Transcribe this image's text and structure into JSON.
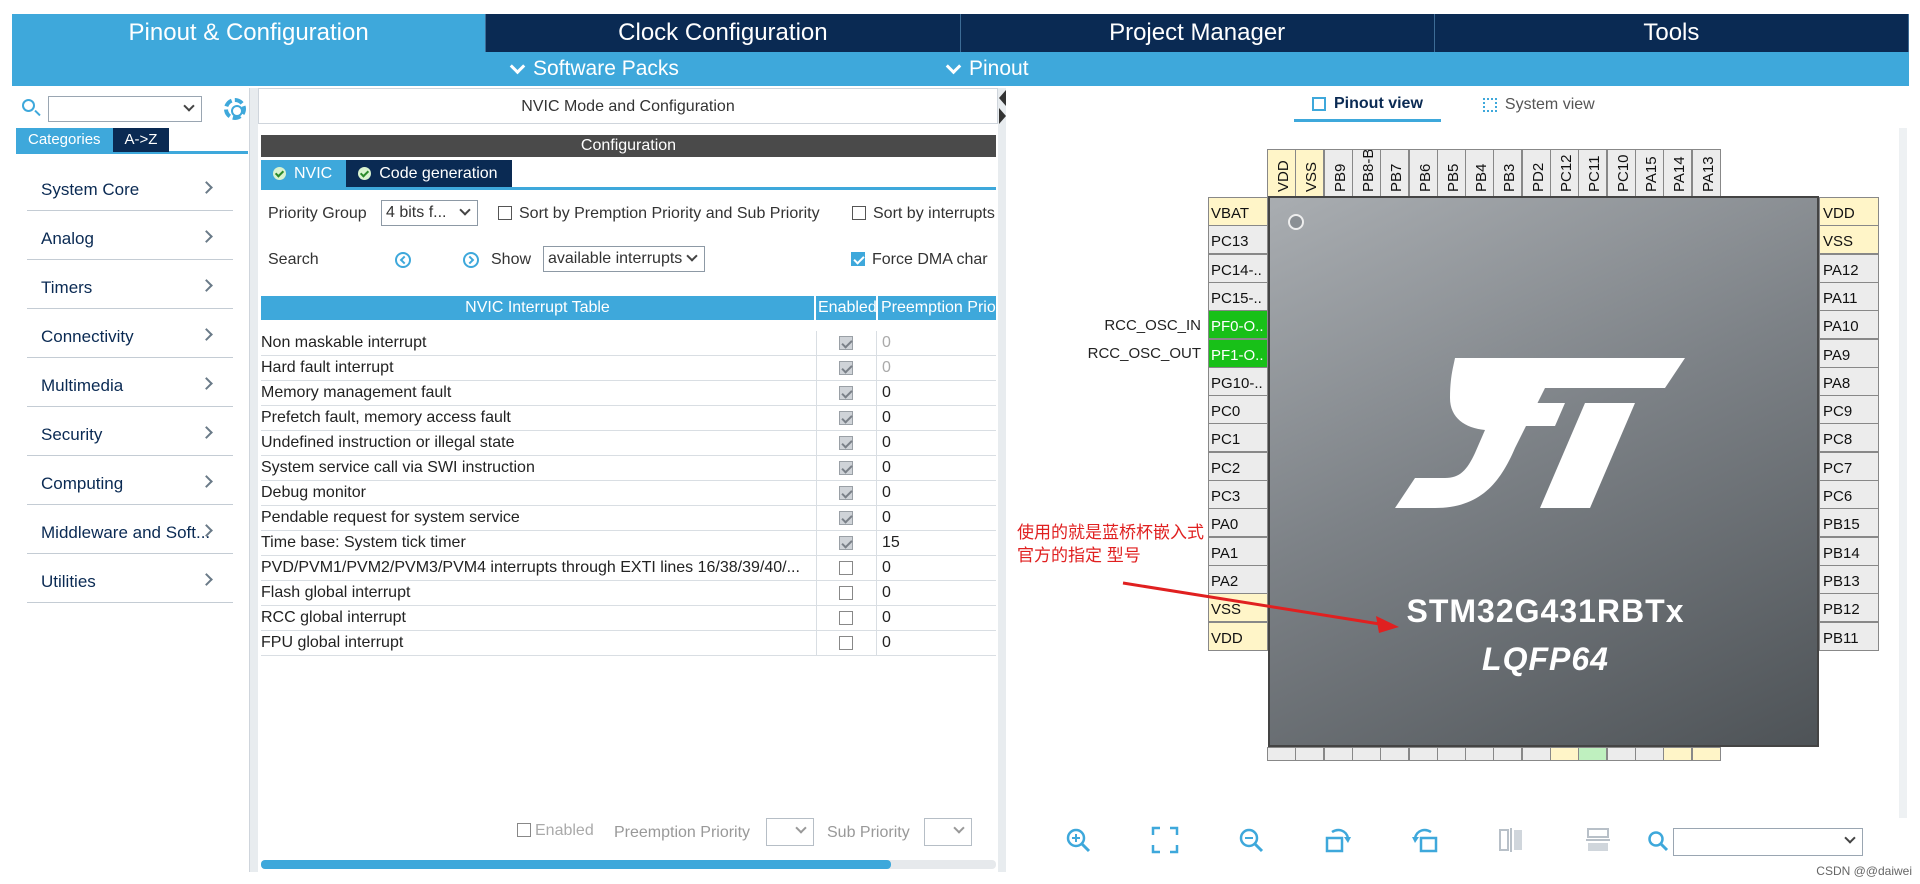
{
  "top_tabs": [
    "Pinout & Configuration",
    "Clock Configuration",
    "Project Manager",
    "Tools"
  ],
  "sub_menu": {
    "software_packs": "Software Packs",
    "pinout": "Pinout"
  },
  "left_panel": {
    "search_value": "",
    "tab_categories": "Categories",
    "tab_az": "A->Z",
    "categories": [
      "System Core",
      "Analog",
      "Timers",
      "Connectivity",
      "Multimedia",
      "Security",
      "Computing",
      "Middleware and Soft...",
      "Utilities"
    ]
  },
  "middle": {
    "title": "NVIC Mode and Configuration",
    "config_bar": "Configuration",
    "tab_nvic": "NVIC",
    "tab_codegen": "Code generation",
    "priority_group_label": "Priority Group",
    "priority_group_value": "4 bits f...",
    "sort_premption": "Sort by Premption Priority and Sub Priority",
    "sort_interrupts": "Sort by interrupts",
    "search_label": "Search",
    "show_label": "Show",
    "show_value": "available interrupts",
    "force_dma": "Force DMA char",
    "table_headers": [
      "NVIC Interrupt Table",
      "Enabled",
      "Preemption Prio"
    ],
    "rows": [
      {
        "name": "Non maskable interrupt",
        "enabled": true,
        "prio": "0",
        "dis": true
      },
      {
        "name": "Hard fault interrupt",
        "enabled": true,
        "prio": "0",
        "dis": true
      },
      {
        "name": "Memory management fault",
        "enabled": true,
        "prio": "0",
        "dis": false
      },
      {
        "name": "Prefetch fault, memory access fault",
        "enabled": true,
        "prio": "0",
        "dis": false
      },
      {
        "name": "Undefined instruction or illegal state",
        "enabled": true,
        "prio": "0",
        "dis": false
      },
      {
        "name": "System service call via SWI instruction",
        "enabled": true,
        "prio": "0",
        "dis": false
      },
      {
        "name": "Debug monitor",
        "enabled": true,
        "prio": "0",
        "dis": false
      },
      {
        "name": "Pendable request for system service",
        "enabled": true,
        "prio": "0",
        "dis": false
      },
      {
        "name": "Time base: System tick timer",
        "enabled": true,
        "prio": "15",
        "dis": false
      },
      {
        "name": "PVD/PVM1/PVM2/PVM3/PVM4 interrupts through EXTI lines 16/38/39/40/...",
        "enabled": false,
        "prio": "0",
        "dis": false
      },
      {
        "name": "Flash global interrupt",
        "enabled": false,
        "prio": "0",
        "dis": false
      },
      {
        "name": "RCC global interrupt",
        "enabled": false,
        "prio": "0",
        "dis": false
      },
      {
        "name": "FPU global interrupt",
        "enabled": false,
        "prio": "0",
        "dis": false
      }
    ],
    "bottom_enabled": "Enabled",
    "bottom_preemption": "Preemption Priority",
    "bottom_sub": "Sub Priority"
  },
  "right": {
    "tab_pinout": "Pinout view",
    "tab_system": "System view",
    "top_pins": [
      "VDD",
      "VSS",
      "PB9",
      "PB8-B..",
      "PB7",
      "PB6",
      "PB5",
      "PB4",
      "PB3",
      "PD2",
      "PC12",
      "PC11",
      "PC10",
      "PA15",
      "PA14",
      "PA13"
    ],
    "left_pins": [
      "VBAT",
      "PC13",
      "PC14-..",
      "PC15-..",
      "PF0-O..",
      "PF1-O..",
      "PG10-..",
      "PC0",
      "PC1",
      "PC2",
      "PC3",
      "PA0",
      "PA1",
      "PA2",
      "VSS",
      "VDD"
    ],
    "right_pins": [
      "VDD",
      "VSS",
      "PA12",
      "PA11",
      "PA10",
      "PA9",
      "PA8",
      "PC9",
      "PC8",
      "PC7",
      "PC6",
      "PB15",
      "PB14",
      "PB13",
      "PB12",
      "PB11"
    ],
    "signal_osc_in": "RCC_OSC_IN",
    "signal_osc_out": "RCC_OSC_OUT",
    "chip_name": "STM32G431RBTx",
    "chip_package": "LQFP64",
    "note_line1": "使用的就是蓝桥杯嵌入式",
    "note_line2": "官方的指定 型号",
    "zoom_value": ""
  },
  "watermark": "CSDN @@daiwei",
  "colors": {
    "accent": "#3ea8db",
    "navy": "#0a2a53",
    "pin_power": "#fff5c8",
    "pin_assigned": "#18c018",
    "note": "#e02020"
  }
}
